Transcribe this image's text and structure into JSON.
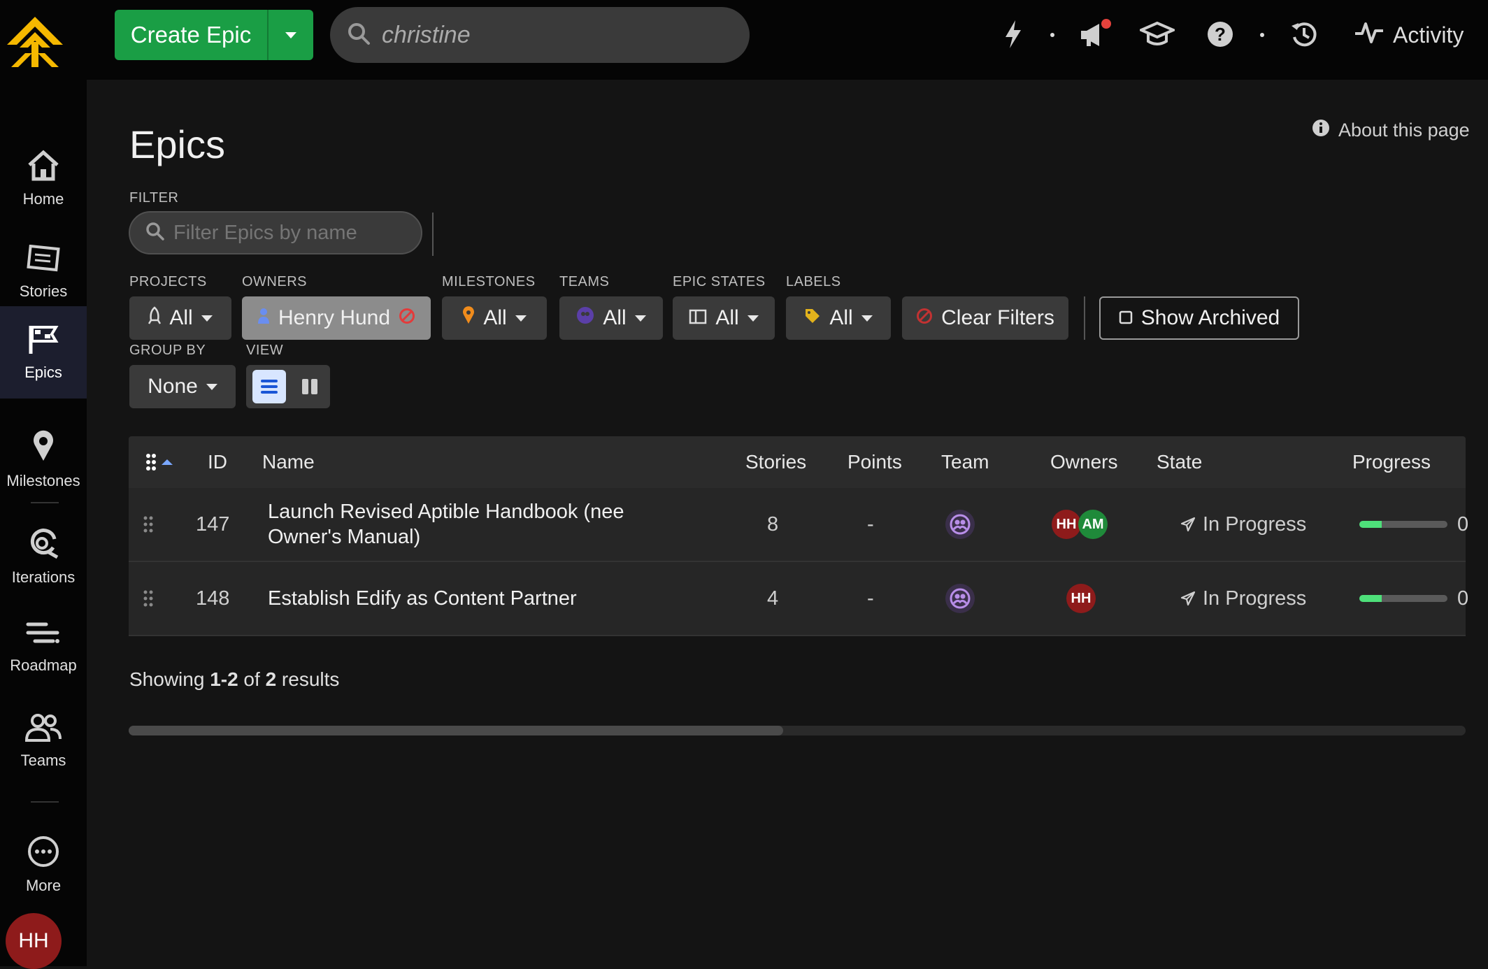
{
  "topbar": {
    "create_label": "Create Epic",
    "search_value": "christine",
    "activity_label": "Activity"
  },
  "sidebar": {
    "items": [
      {
        "label": "Home",
        "icon": "home-icon"
      },
      {
        "label": "Stories",
        "icon": "stories-icon"
      },
      {
        "label": "Epics",
        "icon": "epics-icon"
      },
      {
        "label": "Milestones",
        "icon": "milestone-icon"
      },
      {
        "label": "Iterations",
        "icon": "iteration-icon"
      },
      {
        "label": "Roadmap",
        "icon": "roadmap-icon"
      },
      {
        "label": "Teams",
        "icon": "teams-icon"
      },
      {
        "label": "More",
        "icon": "more-icon"
      }
    ],
    "user_initials": "HH"
  },
  "page": {
    "title": "Epics",
    "about": "About this page",
    "filter_label": "FILTER",
    "filter_placeholder": "Filter Epics by name"
  },
  "filters": {
    "projects": {
      "label": "PROJECTS",
      "value": "All"
    },
    "owners": {
      "label": "OWNERS",
      "value": "Henry Hund"
    },
    "milestones": {
      "label": "MILESTONES",
      "value": "All"
    },
    "teams": {
      "label": "TEAMS",
      "value": "All"
    },
    "states": {
      "label": "EPIC STATES",
      "value": "All"
    },
    "labels": {
      "label": "LABELS",
      "value": "All"
    },
    "clear": "Clear Filters",
    "archived": "Show Archived",
    "group_label": "GROUP BY",
    "group_value": "None",
    "view_label": "VIEW"
  },
  "table": {
    "headers": {
      "id": "ID",
      "name": "Name",
      "stories": "Stories",
      "points": "Points",
      "team": "Team",
      "owners": "Owners",
      "state": "State",
      "progress": "Progress"
    },
    "rows": [
      {
        "id": "147",
        "name_line1": "Launch Revised Aptible Handbook (nee",
        "name_line2": "Owner's Manual)",
        "stories": "8",
        "points": "-",
        "owners": [
          "HH",
          "AM"
        ],
        "state": "In Progress",
        "progress": 0.25,
        "progress_text": "0"
      },
      {
        "id": "148",
        "name_line1": "Establish Edify as Content Partner",
        "name_line2": "",
        "stories": "4",
        "points": "-",
        "owners": [
          "HH"
        ],
        "state": "In Progress",
        "progress": 0.25,
        "progress_text": "0"
      }
    ]
  },
  "results": {
    "prefix": "Showing ",
    "range": "1-2",
    "mid": " of ",
    "total": "2",
    "suffix": " results"
  },
  "colors": {
    "accent_green": "#1a9e45",
    "owner_hh": "#8e1b1b",
    "owner_am": "#1f8a3a",
    "progress": "#4ee07a"
  }
}
